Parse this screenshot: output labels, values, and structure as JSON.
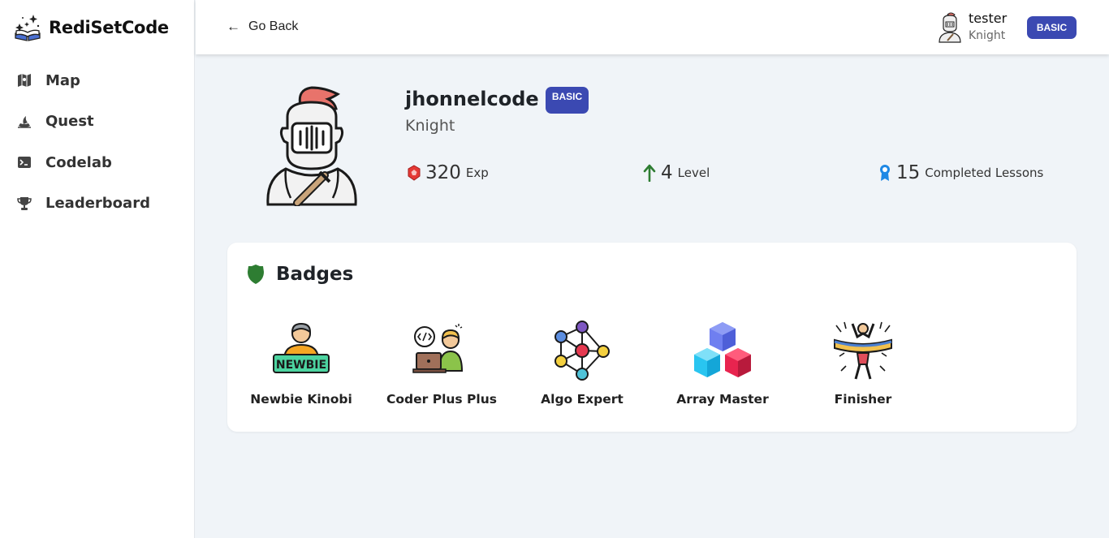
{
  "app": {
    "name": "RediSetCode"
  },
  "sidebar": {
    "items": [
      {
        "label": "Map",
        "icon": "map-icon"
      },
      {
        "label": "Quest",
        "icon": "quest-icon"
      },
      {
        "label": "Codelab",
        "icon": "terminal-icon"
      },
      {
        "label": "Leaderboard",
        "icon": "trophy-icon"
      }
    ]
  },
  "header": {
    "go_back_arrow": "←",
    "go_back_label": "Go Back",
    "user_name": "tester",
    "user_rank": "Knight",
    "plan_badge": "BASIC"
  },
  "profile": {
    "username": "jhonnelcode",
    "plan_badge": "BASIC",
    "rank": "Knight",
    "stats": {
      "exp_value": "320",
      "exp_label": "Exp",
      "level_value": "4",
      "level_label": "Level",
      "lessons_value": "15",
      "lessons_label": "Completed Lessons"
    }
  },
  "badges": {
    "title": "Badges",
    "items": [
      {
        "name": "Newbie Kinobi",
        "icon": "newbie-badge-icon"
      },
      {
        "name": "Coder Plus Plus",
        "icon": "coder-badge-icon"
      },
      {
        "name": "Algo Expert",
        "icon": "algo-badge-icon"
      },
      {
        "name": "Array Master",
        "icon": "array-badge-icon"
      },
      {
        "name": "Finisher",
        "icon": "finisher-badge-icon"
      }
    ]
  },
  "colors": {
    "accent": "#3b49b2",
    "background": "#f0f4f8",
    "exp_icon": "#e53935",
    "level_icon": "#2e7d32",
    "lessons_icon": "#1e88e5",
    "badges_shield": "#2e7d32"
  }
}
